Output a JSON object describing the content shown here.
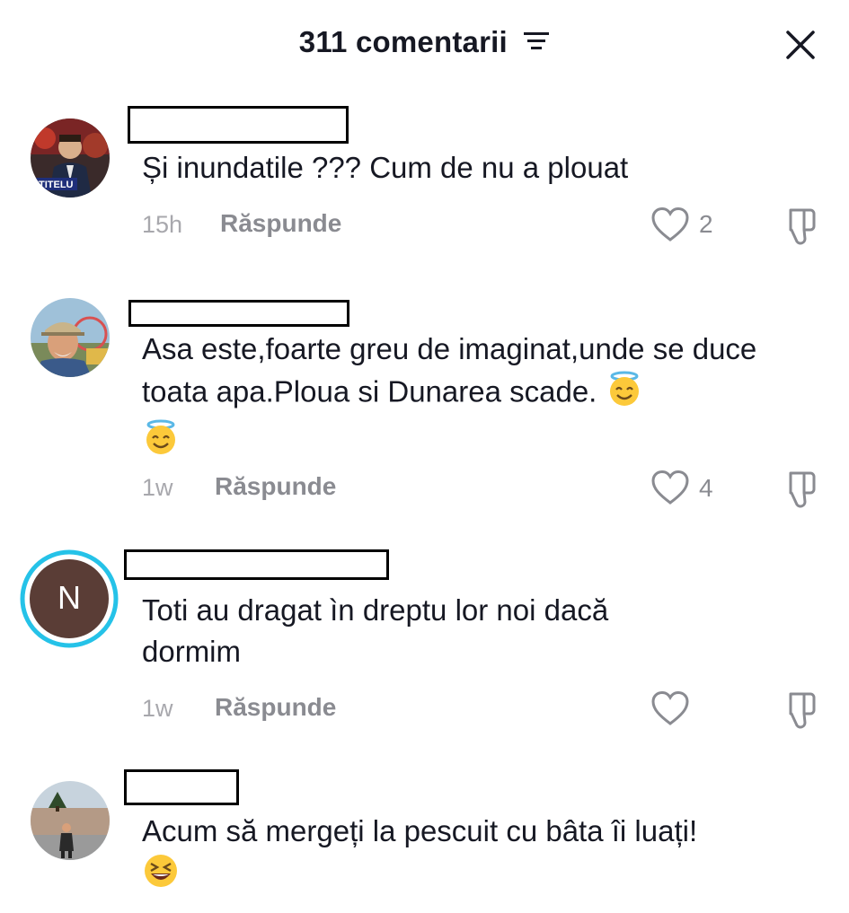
{
  "header": {
    "title": "311 comentarii",
    "sort_icon": "sort-lines-icon",
    "close_icon": "close-icon"
  },
  "comments": [
    {
      "text": "Și inundatile ??? Cum de nu a plouat",
      "time": "15h",
      "reply_label": "Răspunde",
      "likes": "2",
      "avatar_label": "TITELU"
    },
    {
      "text": "Asa este,foarte greu de imaginat,unde se duce toata apa.Ploua si Dunarea scade.",
      "time": "1w",
      "reply_label": "Răspunde",
      "likes": "4"
    },
    {
      "text_line1": "Toti au dragat ìn dreptu lor noi dacă",
      "text_line2": "dormim",
      "time": "1w",
      "reply_label": "Răspunde",
      "likes": "",
      "avatar_letter": "N"
    },
    {
      "text": "Acum să mergeți la pescuit cu bâta îi luați!"
    }
  ],
  "colors": {
    "text": "#161823",
    "muted": "#8a8b91",
    "time": "#a8a8ad",
    "ring": "#25c2e8",
    "avatar_n": "#5a3d36"
  }
}
